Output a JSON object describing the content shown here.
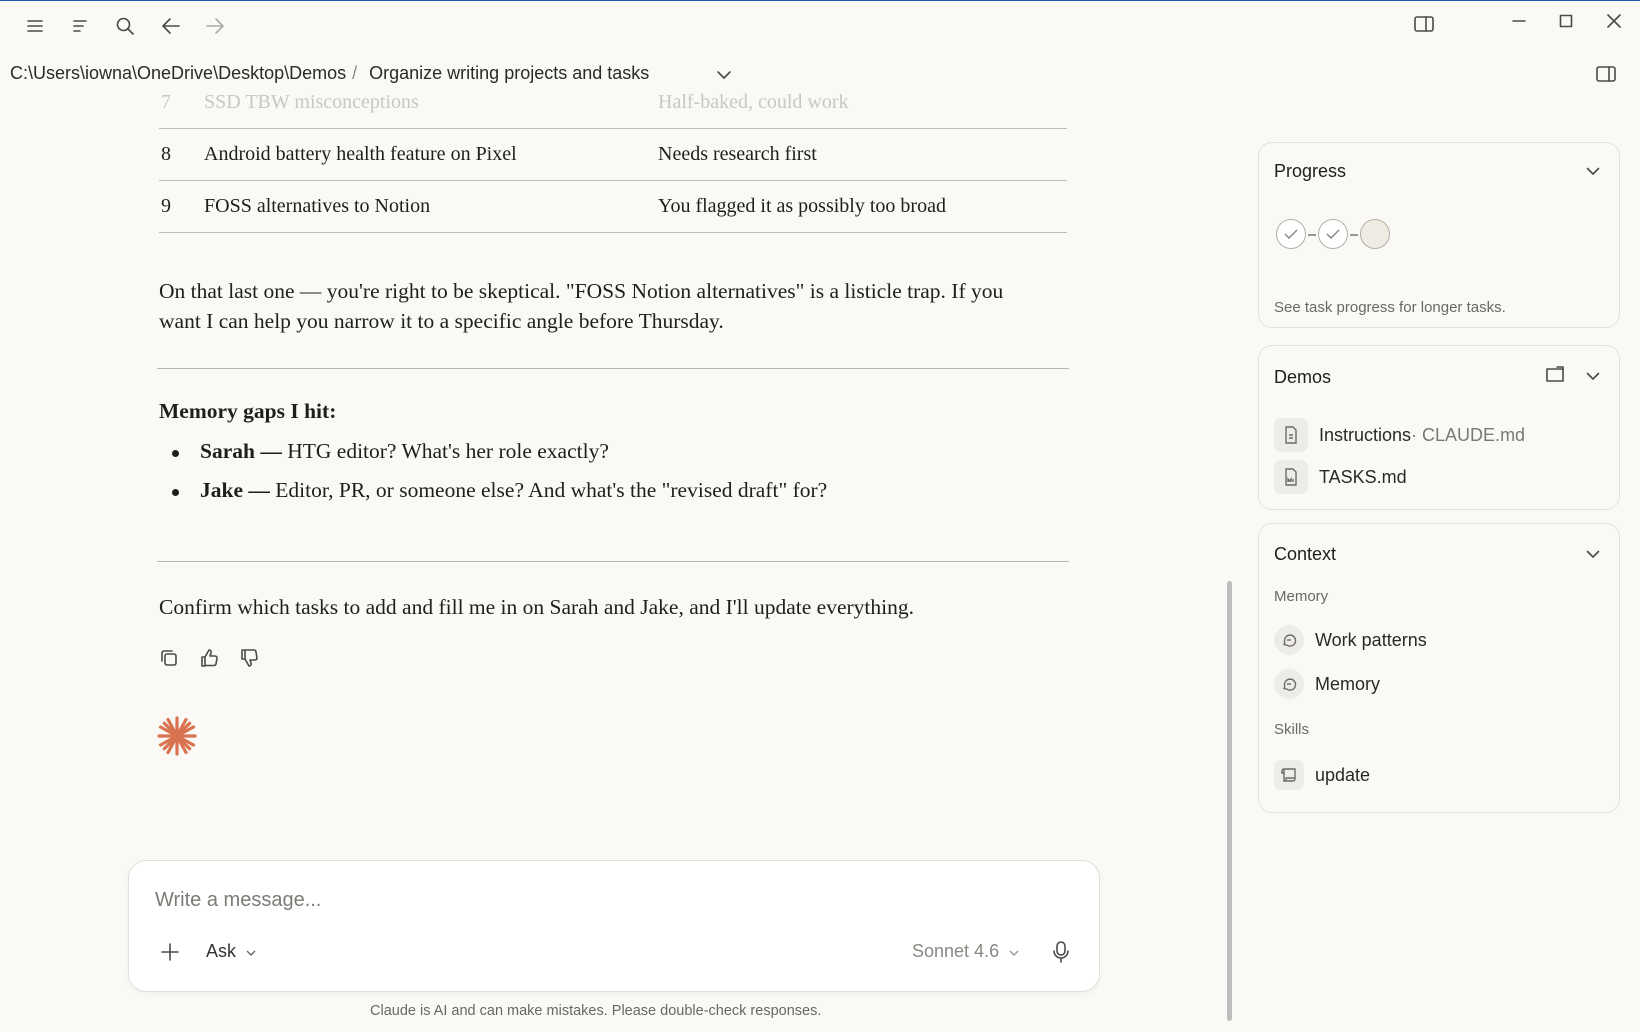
{
  "titlebar": {
    "icons": [
      "menu-icon",
      "sidebar-toggle-icon",
      "search-icon",
      "back-arrow-icon",
      "forward-arrow-icon",
      "panel-icon",
      "minimize-icon",
      "maximize-icon",
      "close-icon"
    ]
  },
  "breadcrumb": {
    "path": "C:\\Users\\iowna\\OneDrive\\Desktop\\Demos",
    "separator": "/",
    "task_title": "Organize writing projects and tasks"
  },
  "table": {
    "rows": [
      {
        "num": "7",
        "topic": "SSD TBW misconceptions",
        "status": "Half-baked, could work"
      },
      {
        "num": "8",
        "topic": "Android battery health feature on Pixel",
        "status": "Needs research first"
      },
      {
        "num": "9",
        "topic": "FOSS alternatives to Notion",
        "status": "You flagged it as possibly too broad"
      }
    ]
  },
  "message": {
    "para1": "On that last one — you're right to be skeptical. \"FOSS Notion alternatives\" is a listicle trap. If you want I can help you narrow it to a specific angle before Thursday.",
    "memory_heading": "Memory gaps I hit:",
    "bullets": [
      {
        "name": "Sarah —",
        "text": " HTG editor? What's her role exactly?"
      },
      {
        "name": "Jake —",
        "text": " Editor, PR, or someone else? And what's the \"revised draft\" for?"
      }
    ],
    "closing": "Confirm which tasks to add and fill me in on Sarah and Jake, and I'll update everything."
  },
  "composer": {
    "placeholder": "Write a message...",
    "mode": "Ask",
    "model": "Sonnet 4.6",
    "disclaimer": "Claude is AI and can make mistakes. Please double-check responses."
  },
  "progress_panel": {
    "title": "Progress",
    "steps": [
      "done",
      "done",
      "pending"
    ],
    "hint": "See task progress for longer tasks."
  },
  "demos_panel": {
    "title": "Demos",
    "files": [
      {
        "name": "Instructions",
        "suffix": " · CLAUDE.md"
      },
      {
        "name": "TASKS.md",
        "suffix": ""
      }
    ]
  },
  "context_panel": {
    "title": "Context",
    "memory_label": "Memory",
    "memory_items": [
      "Work patterns",
      "Memory"
    ],
    "skills_label": "Skills",
    "skills_items": [
      "update"
    ]
  },
  "colors": {
    "accent": "#d9734f",
    "background": "#faf9f5",
    "window_border": "#1e5aa8"
  }
}
